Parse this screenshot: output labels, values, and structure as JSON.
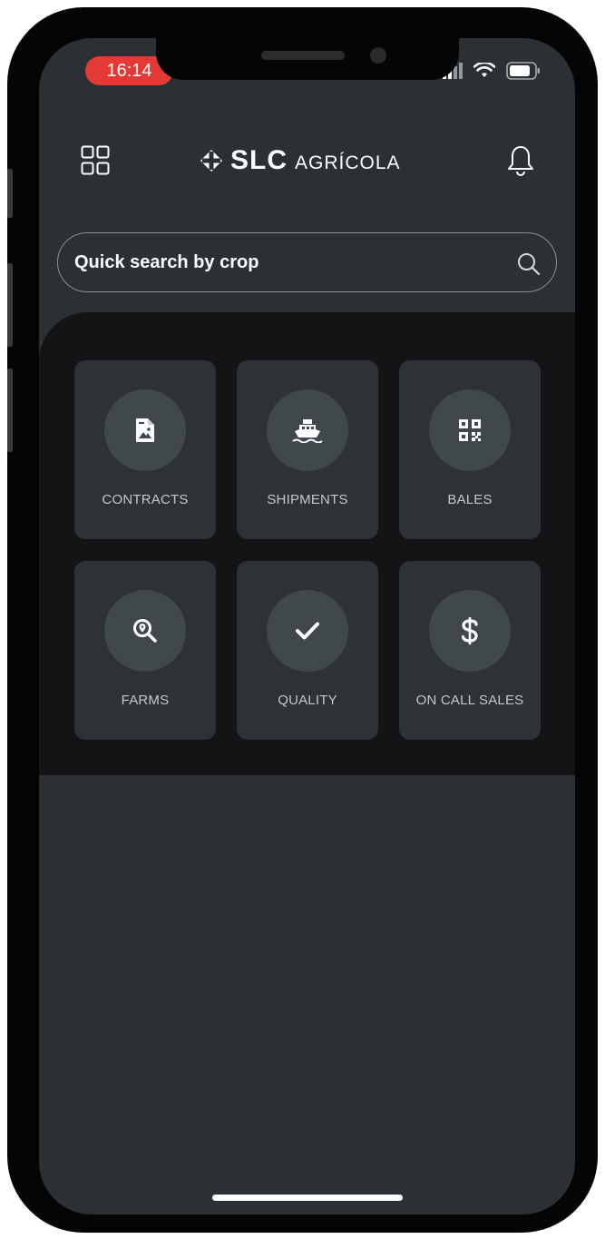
{
  "status_bar": {
    "time": "16:14"
  },
  "header": {
    "brand_main": "SLC",
    "brand_sub": "AGRÍCOLA",
    "menu_icon": "grid-icon",
    "notification_icon": "bell-icon"
  },
  "search": {
    "placeholder": "Quick search by crop",
    "icon": "search-icon"
  },
  "menu": {
    "items": [
      {
        "label": "CONTRACTS",
        "icon": "document-icon"
      },
      {
        "label": "SHIPMENTS",
        "icon": "ship-icon"
      },
      {
        "label": "BALES",
        "icon": "qr-code-icon"
      },
      {
        "label": "FARMS",
        "icon": "location-search-icon"
      },
      {
        "label": "QUALITY",
        "icon": "check-icon"
      },
      {
        "label": "ON CALL SALES",
        "icon": "dollar-icon"
      }
    ]
  },
  "colors": {
    "background": "#2a3033",
    "panel": "#141416",
    "tile": "#2c3235",
    "icon_circle": "#41484b",
    "time_badge": "#e53935"
  }
}
